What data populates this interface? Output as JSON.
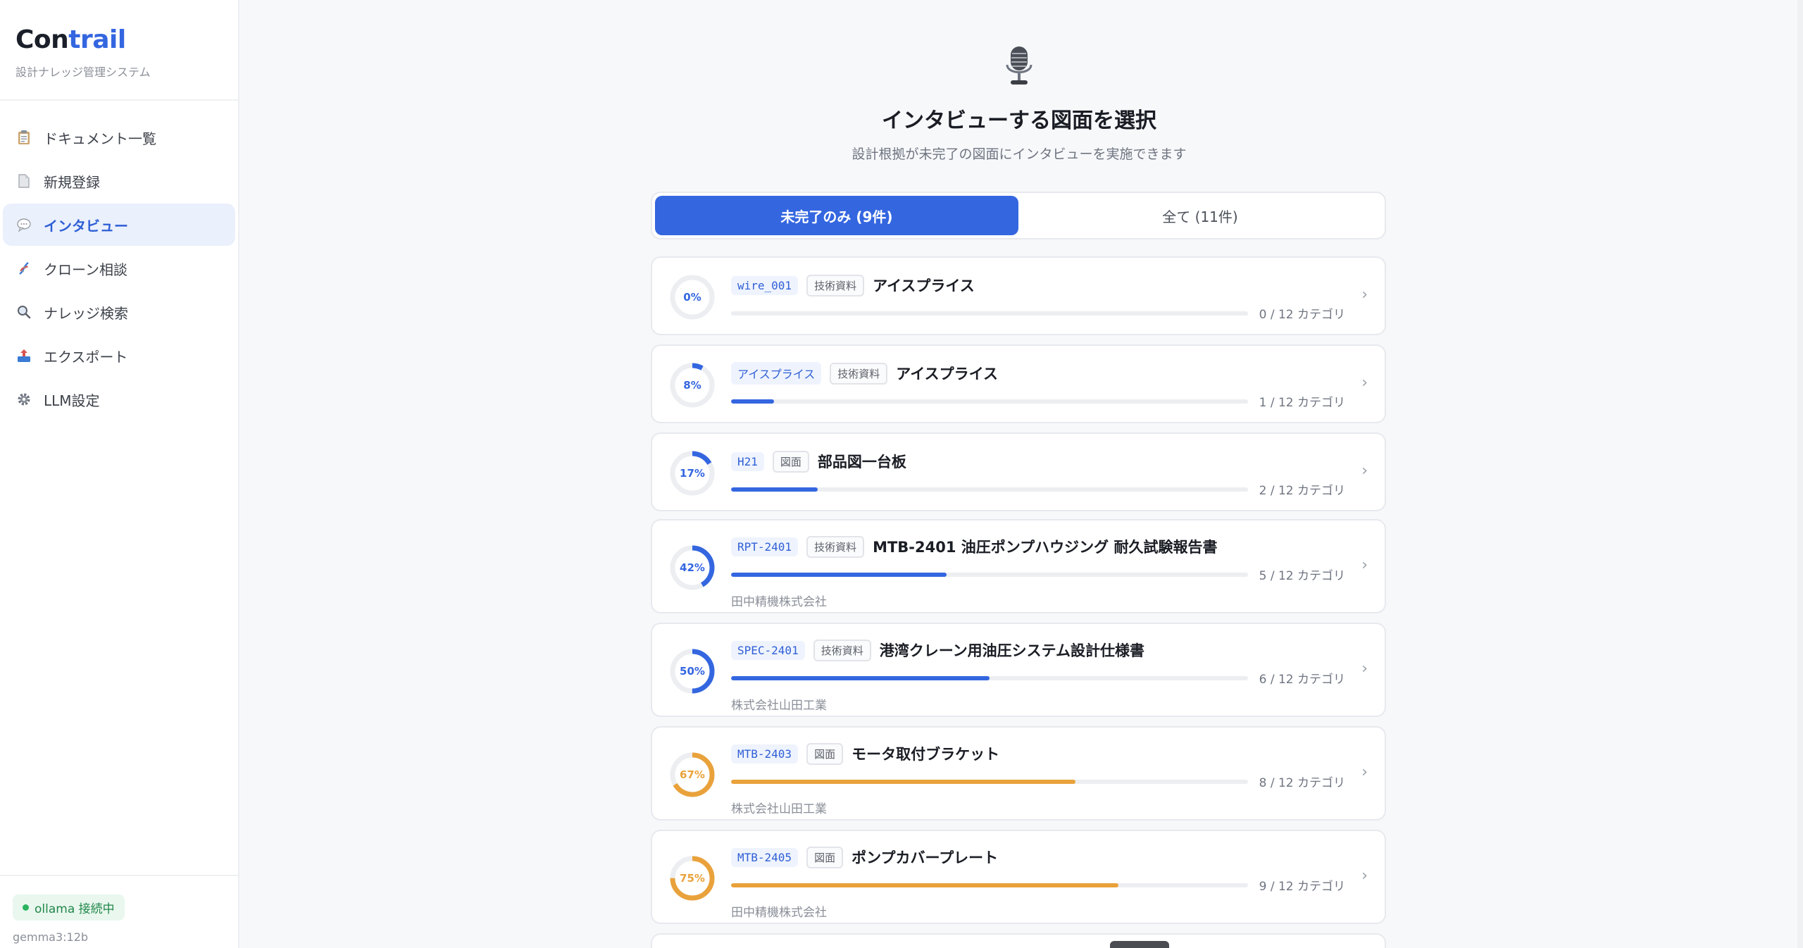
{
  "brand": {
    "logo_part1": "Con",
    "logo_part2": "trail",
    "subtitle": "設計ナレッジ管理システム"
  },
  "sidebar": {
    "items": [
      {
        "label": "ドキュメント一覧",
        "icon": "clipboard-icon"
      },
      {
        "label": "新規登録",
        "icon": "document-icon"
      },
      {
        "label": "インタビュー",
        "icon": "speech-bubble-icon",
        "active": true
      },
      {
        "label": "クローン相談",
        "icon": "dna-icon"
      },
      {
        "label": "ナレッジ検索",
        "icon": "magnifier-icon"
      },
      {
        "label": "エクスポート",
        "icon": "outbox-icon"
      },
      {
        "label": "LLM設定",
        "icon": "gear-icon"
      }
    ],
    "status": "ollama 接続中",
    "model": "gemma3:12b"
  },
  "header": {
    "icon": "microphone-icon",
    "title": "インタビューする図面を選択",
    "subtitle": "設計根拠が未完了の図面にインタビューを実施できます"
  },
  "tabs": [
    {
      "label": "未完了のみ (9件)",
      "active": true
    },
    {
      "label": "全て (11件)",
      "active": false
    }
  ],
  "colors": {
    "accent": "#3466e0",
    "warning": "#e9a23b"
  },
  "items": [
    {
      "code": "wire_001",
      "type": "技術資料",
      "title": "アイスプライス",
      "percent_label": "0%",
      "progress": 0.0,
      "count": "0 / 12 カテゴリ",
      "company": ""
    },
    {
      "code": "アイスプライス",
      "type": "技術資料",
      "title": "アイスプライス",
      "percent_label": "8%",
      "progress": 0.083,
      "count": "1 / 12 カテゴリ",
      "company": ""
    },
    {
      "code": "H21",
      "type": "図面",
      "title": "部品図一台板",
      "percent_label": "17%",
      "progress": 0.167,
      "count": "2 / 12 カテゴリ",
      "company": ""
    },
    {
      "code": "RPT-2401",
      "type": "技術資料",
      "title": "MTB-2401 油圧ポンプハウジング 耐久試験報告書",
      "percent_label": "42%",
      "progress": 0.417,
      "count": "5 / 12 カテゴリ",
      "company": "田中精機株式会社"
    },
    {
      "code": "SPEC-2401",
      "type": "技術資料",
      "title": "港湾クレーン用油圧システム設計仕様書",
      "percent_label": "50%",
      "progress": 0.5,
      "count": "6 / 12 カテゴリ",
      "company": "株式会社山田工業"
    },
    {
      "code": "MTB-2403",
      "type": "図面",
      "title": "モータ取付ブラケット",
      "percent_label": "67%",
      "progress": 0.667,
      "count": "8 / 12 カテゴリ",
      "company": "株式会社山田工業"
    },
    {
      "code": "MTB-2405",
      "type": "図面",
      "title": "ポンプカバープレート",
      "percent_label": "75%",
      "progress": 0.75,
      "count": "9 / 12 カテゴリ",
      "company": "田中精機株式会社"
    }
  ]
}
